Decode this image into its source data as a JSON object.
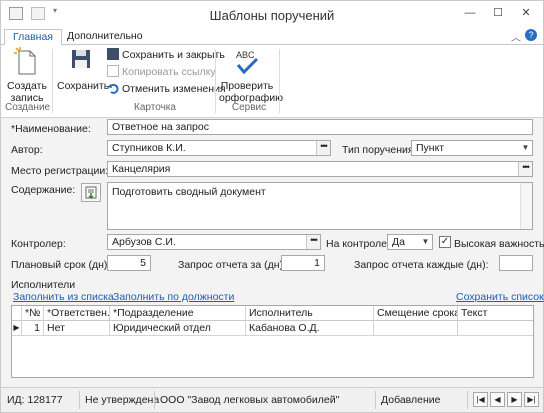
{
  "window": {
    "title": "Шаблоны поручений",
    "minimize": "—",
    "maximize": "☐",
    "close": "✕"
  },
  "ribbon": {
    "tabs": [
      "Главная",
      "Дополнительно"
    ],
    "groups": {
      "create": {
        "label": "Создание",
        "create_record": [
          "Создать",
          "запись"
        ]
      },
      "card": {
        "label": "Карточка",
        "save": "Сохранить",
        "save_close": "Сохранить и закрыть",
        "copy_link": "Копировать ссылку",
        "undo": "Отменить изменения"
      },
      "service": {
        "label": "Сервис",
        "spell_check": [
          "Проверить",
          "орфографию"
        ],
        "abc": "ABC"
      }
    }
  },
  "form": {
    "name_label": "*Наименование:",
    "name_value": "Ответное на запрос",
    "author_label": "Автор:",
    "author_value": "Ступников К.И.",
    "type_label": "Тип поручения:",
    "type_value": "Пункт",
    "reg_place_label": "Место регистрации:",
    "reg_place_value": "Канцелярия",
    "content_label": "Содержание:",
    "content_value": "Подготовить сводный документ",
    "controller_label": "Контролер:",
    "controller_value": "Арбузов С.И.",
    "on_control_label": "На контроле:",
    "on_control_value": "Да",
    "high_importance_label": "Высокая важность",
    "high_importance_checked": true,
    "plan_term_label": "Плановый срок (дн):",
    "plan_term_value": "5",
    "report_request_label": "Запрос отчета за (дн):",
    "report_request_value": "1",
    "report_every_label": "Запрос отчета каждые (дн):",
    "report_every_value": ""
  },
  "executors": {
    "section_label": "Исполнители",
    "fill_from_list": "Заполнить из списка",
    "fill_by_position": "Заполнить по должности",
    "save_list": "Сохранить список",
    "columns": [
      "*№",
      "*Ответствен...",
      "*Подразделение",
      "Исполнитель",
      "Смещение срока ...",
      "Текст"
    ],
    "rows": [
      [
        "1",
        "Нет",
        "Юридический отдел",
        "Кабанова О.Д.",
        "",
        ""
      ]
    ]
  },
  "statusbar": {
    "id": "ИД: 128177",
    "state": "Не утверждена",
    "org": "ООО \"Завод легковых автомобилей\"",
    "mode": "Добавление"
  }
}
